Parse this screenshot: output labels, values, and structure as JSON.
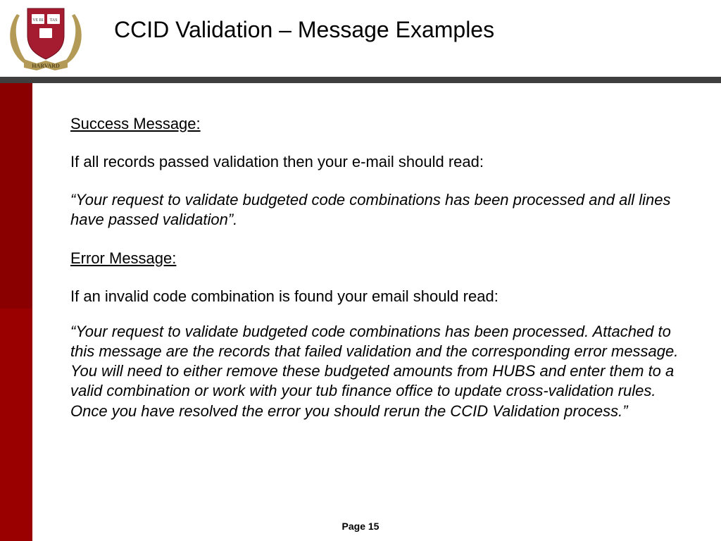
{
  "header": {
    "title": "CCID Validation – Message Examples",
    "logo_alt": "Harvard shield with wreath"
  },
  "content": {
    "success_heading": "Success Message:",
    "success_intro": "If all records passed validation then your e-mail should read:",
    "success_quote": "“Your request to validate budgeted code combinations has been processed and all lines have passed validation”.",
    "error_heading": "Error Message:",
    "error_intro": "If an invalid code combination is found your email should read:",
    "error_quote": "“Your request to validate budgeted code combinations has been processed. Attached to this message are the records that failed validation and the corresponding error message. You will need to either remove these budgeted amounts from HUBS and enter them to a valid combination or work with your tub finance office to update cross-validation rules. Once you have resolved the error you should rerun the CCID Validation process.”"
  },
  "footer": {
    "page_label": "Page 15"
  }
}
